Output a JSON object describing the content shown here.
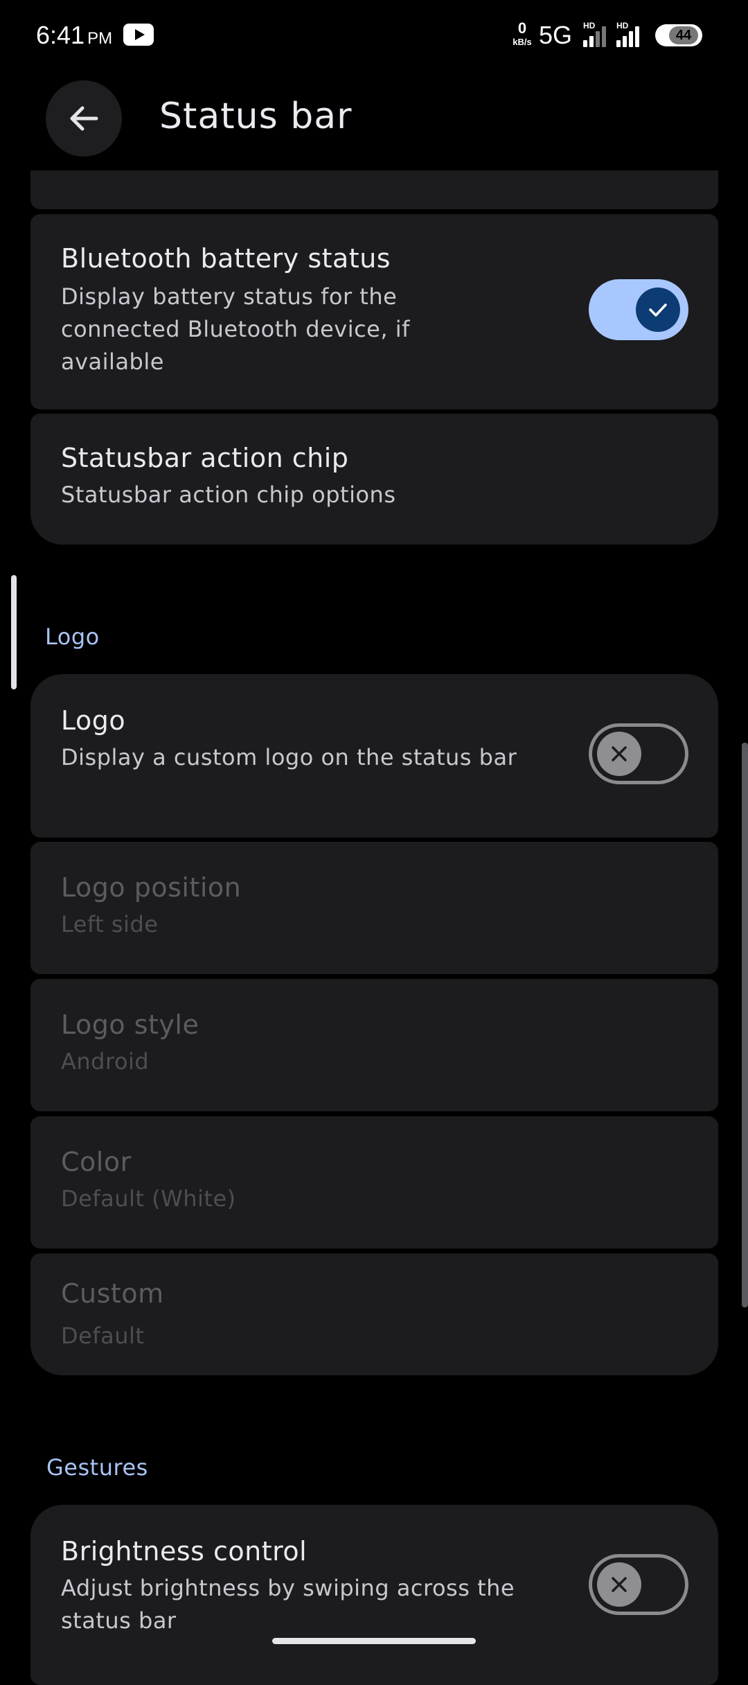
{
  "status_bar": {
    "time": "6:41",
    "ampm": "PM",
    "speed_value": "0",
    "speed_unit": "kB/s",
    "network": "5G",
    "hd1": "HD",
    "hd2": "HD",
    "battery": "44"
  },
  "header": {
    "title": "Status bar"
  },
  "items": {
    "bluetooth": {
      "title": "Bluetooth battery status",
      "subtitle": "Display battery status for the connected Bluetooth device, if available",
      "enabled": true
    },
    "action_chip": {
      "title": "Statusbar action chip",
      "subtitle": "Statusbar action chip options"
    }
  },
  "sections": {
    "logo": "Logo",
    "gestures": "Gestures"
  },
  "logo_items": {
    "logo": {
      "title": "Logo",
      "subtitle": "Display a custom logo on the status bar",
      "enabled": false
    },
    "position": {
      "title": "Logo position",
      "subtitle": "Left side"
    },
    "style": {
      "title": "Logo style",
      "subtitle": "Android"
    },
    "color": {
      "title": "Color",
      "subtitle": "Default (White)"
    },
    "custom": {
      "title": "Custom",
      "subtitle": "Default"
    }
  },
  "gesture_items": {
    "brightness": {
      "title": "Brightness control",
      "subtitle": "Adjust brightness by swiping across the status bar",
      "enabled": false
    }
  },
  "colors": {
    "background": "#000000",
    "card": "#1c1c1e",
    "accent": "#a9c7ff",
    "section_header": "#a8c4f5"
  }
}
